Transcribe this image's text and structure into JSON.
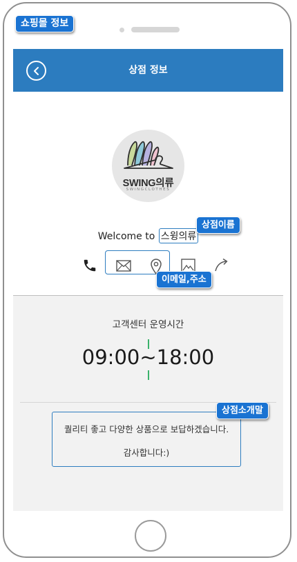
{
  "annotations": {
    "page": "쇼핑몰 정보",
    "store_name": "상점이름",
    "email_address": "이메일,주소",
    "store_intro": "상점소개말"
  },
  "app_bar": {
    "title": "상점 정보",
    "back_icon": "chevron-left-circle-icon"
  },
  "logo": {
    "brand": "SWING의류",
    "tagline": "SWINGCLOTHES"
  },
  "store": {
    "welcome_prefix": "Welcome to",
    "name": "스윙의류"
  },
  "contact_icons": [
    "phone-icon",
    "mail-icon",
    "location-pin-icon",
    "image-icon",
    "share-icon"
  ],
  "hours": {
    "label": "고객센터 운영시간",
    "value": "09:00~18:00"
  },
  "intro": {
    "line1": "퀄리티 좋고 다양한 상품으로 보답하겠습니다.",
    "line2": "감사합니다:)"
  },
  "colors": {
    "primary": "#2c7cbf",
    "annotation": "#1a73d2",
    "accent_green": "#3ab26b",
    "section_bg": "#f2f2f2"
  }
}
